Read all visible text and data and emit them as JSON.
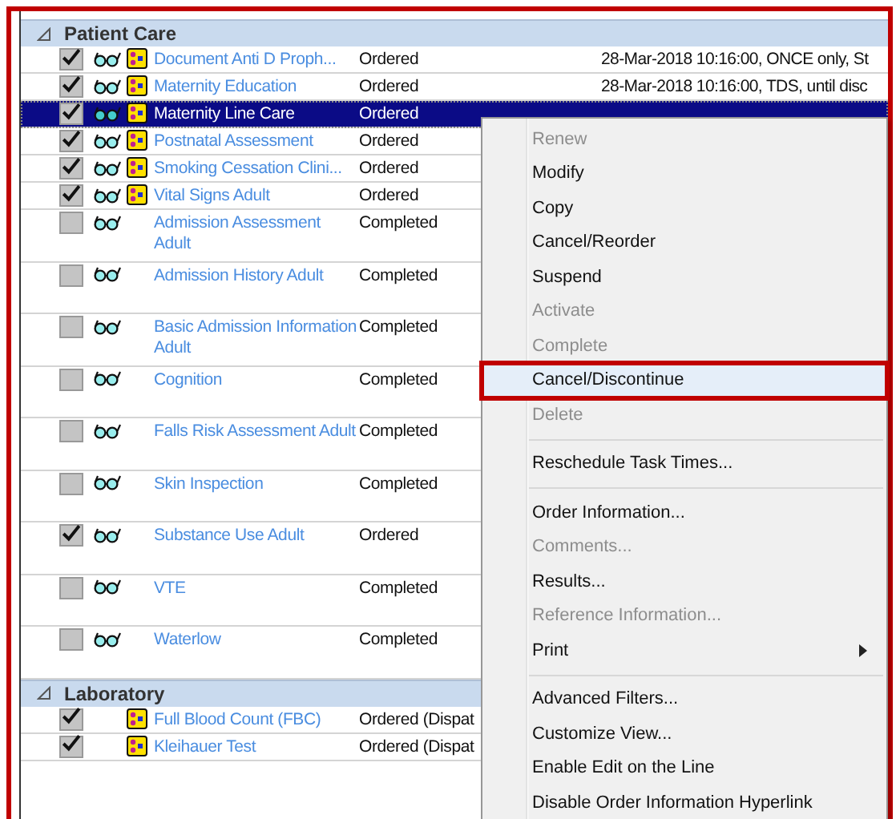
{
  "groups": [
    {
      "title": "Patient Care",
      "expanded": true,
      "rows": [
        {
          "checked": true,
          "glasses": true,
          "order_icon": true,
          "name": "Document Anti D Proph...",
          "status": "Ordered",
          "detail": "28-Mar-2018 10:16:00, ONCE only, St",
          "selected": false,
          "tall": false
        },
        {
          "checked": true,
          "glasses": true,
          "order_icon": true,
          "name": "Maternity Education",
          "status": "Ordered",
          "detail": "28-Mar-2018 10:16:00, TDS, until disc",
          "selected": false,
          "tall": false
        },
        {
          "checked": true,
          "glasses": true,
          "order_icon": true,
          "name": "Maternity Line Care",
          "status": "Ordered",
          "selected": true,
          "tall": false
        },
        {
          "checked": true,
          "glasses": true,
          "order_icon": true,
          "name": "Postnatal Assessment",
          "status": "Ordered",
          "selected": false,
          "tall": false
        },
        {
          "checked": true,
          "glasses": true,
          "order_icon": true,
          "name": "Smoking Cessation Clini...",
          "status": "Ordered",
          "selected": false,
          "tall": false
        },
        {
          "checked": true,
          "glasses": true,
          "order_icon": true,
          "name": "Vital Signs Adult",
          "status": "Ordered",
          "selected": false,
          "tall": false
        },
        {
          "checked": false,
          "glasses": true,
          "order_icon": false,
          "name": "Admission Assessment Adult",
          "status": "Completed",
          "selected": false,
          "tall": true
        },
        {
          "checked": false,
          "glasses": true,
          "order_icon": false,
          "name": "Admission History Adult",
          "status": "Completed",
          "selected": false,
          "tall": true
        },
        {
          "checked": false,
          "glasses": true,
          "order_icon": false,
          "name": "Basic Admission Information Adult",
          "status": "Completed",
          "selected": false,
          "tall": true
        },
        {
          "checked": false,
          "glasses": true,
          "order_icon": false,
          "name": "Cognition",
          "status": "Completed",
          "selected": false,
          "tall": true
        },
        {
          "checked": false,
          "glasses": true,
          "order_icon": false,
          "name": "Falls Risk Assessment Adult",
          "status": "Completed",
          "selected": false,
          "tall": true
        },
        {
          "checked": false,
          "glasses": true,
          "order_icon": false,
          "name": "Skin Inspection",
          "status": "Completed",
          "selected": false,
          "tall": true
        },
        {
          "checked": true,
          "glasses": true,
          "order_icon": false,
          "name": "Substance Use Adult",
          "status": "Ordered",
          "selected": false,
          "tall": true
        },
        {
          "checked": false,
          "glasses": true,
          "order_icon": false,
          "name": "VTE",
          "status": "Completed",
          "selected": false,
          "tall": true
        },
        {
          "checked": false,
          "glasses": true,
          "order_icon": false,
          "name": "Waterlow",
          "status": "Completed",
          "selected": false,
          "tall": true
        }
      ]
    },
    {
      "title": "Laboratory",
      "expanded": true,
      "rows": [
        {
          "checked": true,
          "glasses": false,
          "order_icon": true,
          "name": "Full Blood Count (FBC)",
          "status": "Ordered (Dispat",
          "selected": false,
          "tall": false
        },
        {
          "checked": true,
          "glasses": false,
          "order_icon": true,
          "name": "Kleihauer Test",
          "status": "Ordered (Dispat",
          "selected": false,
          "tall": false
        }
      ]
    }
  ],
  "context_menu": [
    {
      "kind": "item",
      "label": "Renew",
      "disabled": true,
      "highlighted": false
    },
    {
      "kind": "item",
      "label": "Modify",
      "disabled": false,
      "highlighted": false
    },
    {
      "kind": "item",
      "label": "Copy",
      "disabled": false,
      "highlighted": false
    },
    {
      "kind": "item",
      "label": "Cancel/Reorder",
      "disabled": false,
      "highlighted": false
    },
    {
      "kind": "item",
      "label": "Suspend",
      "disabled": false,
      "highlighted": false
    },
    {
      "kind": "item",
      "label": "Activate",
      "disabled": true,
      "highlighted": false
    },
    {
      "kind": "item",
      "label": "Complete",
      "disabled": true,
      "highlighted": false
    },
    {
      "kind": "item",
      "label": "Cancel/Discontinue",
      "disabled": false,
      "highlighted": true
    },
    {
      "kind": "item",
      "label": "Delete",
      "disabled": true,
      "highlighted": false
    },
    {
      "kind": "separator"
    },
    {
      "kind": "item",
      "label": "Reschedule Task Times...",
      "disabled": false,
      "highlighted": false
    },
    {
      "kind": "separator"
    },
    {
      "kind": "item",
      "label": "Order Information...",
      "disabled": false,
      "highlighted": false
    },
    {
      "kind": "item",
      "label": "Comments...",
      "disabled": true,
      "highlighted": false
    },
    {
      "kind": "item",
      "label": "Results...",
      "disabled": false,
      "highlighted": false
    },
    {
      "kind": "item",
      "label": "Reference Information...",
      "disabled": true,
      "highlighted": false
    },
    {
      "kind": "submenu",
      "label": "Print",
      "disabled": false,
      "highlighted": false
    },
    {
      "kind": "separator"
    },
    {
      "kind": "item",
      "label": "Advanced Filters...",
      "disabled": false,
      "highlighted": false
    },
    {
      "kind": "item",
      "label": "Customize View...",
      "disabled": false,
      "highlighted": false
    },
    {
      "kind": "item",
      "label": "Enable Edit on the Line",
      "disabled": false,
      "highlighted": false
    },
    {
      "kind": "item",
      "label": "Disable Order Information Hyperlink",
      "disabled": false,
      "highlighted": false
    }
  ]
}
